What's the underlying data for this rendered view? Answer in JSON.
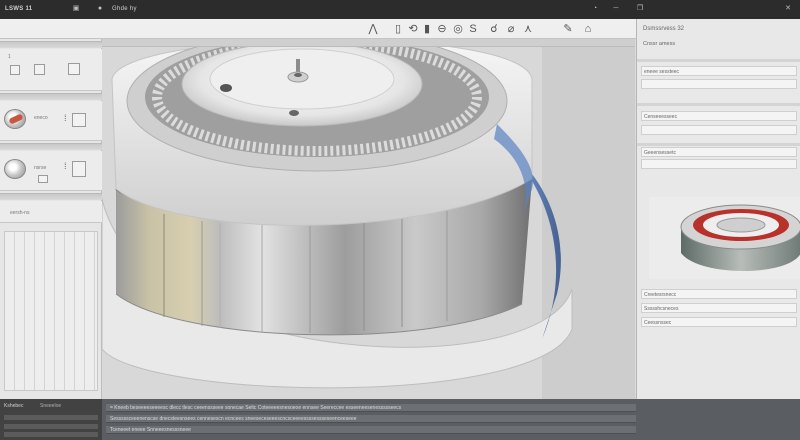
{
  "window": {
    "title": "LSWS 11",
    "subtitle": "Ghde hy"
  },
  "titlebar_icons": [
    "clock-icon",
    "minimize-icon",
    "restore-icon",
    "close-icon"
  ],
  "toolbar": {
    "tools": [
      {
        "name": "move-tool",
        "glyph": "⋀"
      },
      {
        "name": "page-tool",
        "glyph": "▯"
      },
      {
        "name": "rotate-tool",
        "glyph": "⟲"
      },
      {
        "name": "bar-tool",
        "glyph": "▮"
      },
      {
        "name": "circle-tool",
        "glyph": "⊖"
      },
      {
        "name": "ring-tool",
        "glyph": "◎"
      },
      {
        "name": "s-tool",
        "glyph": "S"
      },
      {
        "name": "dial-tool",
        "glyph": "☌"
      },
      {
        "name": "brush-tool",
        "glyph": "⌀"
      },
      {
        "name": "chevron-tool",
        "glyph": "⋏"
      },
      {
        "name": "pen-tool",
        "glyph": "✎"
      },
      {
        "name": "mirror-tool",
        "glyph": "⌂"
      }
    ]
  },
  "left_panel": {
    "header1": "1",
    "item1_label": "eneco",
    "item2_label": "nsrse",
    "section_label": "eersh-ns",
    "bottom_tab_1": "Kshebec",
    "bottom_tab_2": "Sneeeloe"
  },
  "right_panel": {
    "title": "Dsmssrvess 32",
    "subtitle": "Cnssr amess",
    "field1": "eneee sessteec",
    "field2": "Censeeesseec",
    "field3": "Geeensessetc",
    "section1": "Creetesrsnecc",
    "section2": "Ssssshcsneces",
    "section3": "Ceessnssec"
  },
  "bottom_panel": {
    "rows": [
      "= Kneeb beseeeeseeeesc  dlecc  tlesc  ceeenssseee  sonecae  Seltc  Coteeeeesnesoeoe  ennsee   Seereccee esseeneesenessssseecs",
      "Sesssssceeenenscse  dnecsteesnsees  cennesescn ecncees  sneeseceseeescncsceeeessssessseseenceeseee",
      "Tceneeet  eneee  Snneeesnesssneee"
    ]
  },
  "colors": {
    "accent_blue": "#4f77b8",
    "accent_red": "#b8312a",
    "titlebar": "#2c2c2c"
  }
}
